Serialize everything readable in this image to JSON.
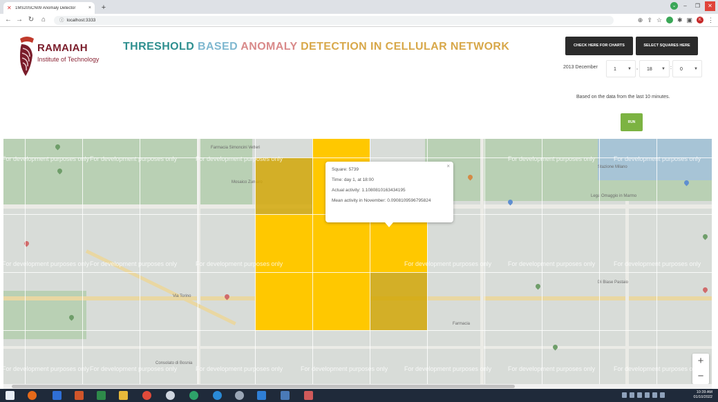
{
  "browser": {
    "tab_title": "1MS20SCN09 Anomaly Detector",
    "tab_close": "×",
    "new_tab": "+",
    "url": "localhost:3333"
  },
  "logo": {
    "name": "RAMAIAH",
    "sub": "Institute of Technology"
  },
  "title": {
    "part1": "THRESHOLD",
    "part2": "BASED",
    "part3": "ANOMALY",
    "part4": "DETECTION IN CELLULAR NETWORK"
  },
  "buttons": {
    "charts": "CHECK HERE FOR CHARTS",
    "squares": "SELECT SQUARES HERE",
    "run": "RUN"
  },
  "date": {
    "label": "2013 December",
    "day": "1",
    "hour": "18",
    "minute": "0",
    "sep1": ",",
    "sep2": ":"
  },
  "info_text": "Based on the data from the last 10 minutes.",
  "map": {
    "watermark": "For development purposes only",
    "popup": {
      "square": "Square: 5739",
      "time": "Time: day 1, at 18:00",
      "actual": "Actual activity: 1.10808101634341​95",
      "mean": "Mean activity in November: 0.0908109596795824",
      "close": "×"
    },
    "labels": {
      "farmacia": "Farmacia Simoncini Vetteri",
      "mosaico": "Mosaico Zumaro",
      "stazione": "Stazione Milano",
      "lega": "Lega Omaggio in Marmo",
      "dibiase": "Di Biase Pastaio",
      "farmacia2": "Farmacia",
      "viatorino": "Via Torino",
      "consolato": "Consolato di Bosnia"
    },
    "zoom_in": "+",
    "zoom_out": "−"
  },
  "taskbar": {
    "time": "10:39 AM",
    "date": "01/10/2022"
  },
  "colors": {
    "anomaly_square": "#ffc800",
    "run_button": "#7cb342",
    "header_button": "#2b2b2b"
  }
}
